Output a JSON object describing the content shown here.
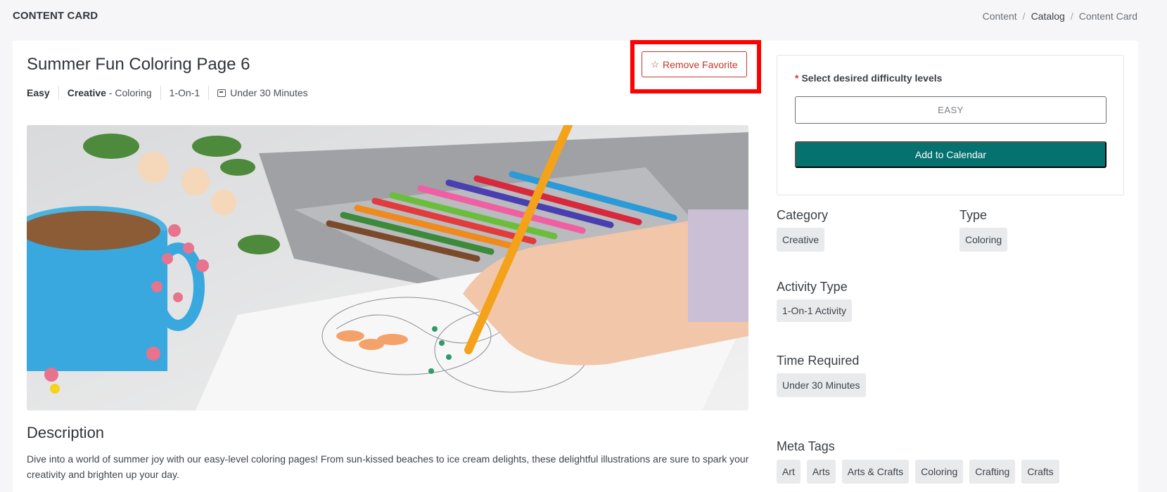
{
  "header": {
    "title": "CONTENT CARD",
    "breadcrumb": [
      "Content",
      "Catalog",
      "Content Card"
    ]
  },
  "content": {
    "title": "Summer Fun Coloring Page 6",
    "meta": {
      "difficulty": "Easy",
      "category_bold": "Creative",
      "category_rest": "- Coloring",
      "activity": "1-On-1",
      "time": "Under 30 Minutes"
    },
    "favorite_button": "Remove Favorite",
    "hero_image_alt": "Hand coloring a page with pencils",
    "description_title": "Description",
    "description_text": "Dive into a world of summer joy with our easy-level coloring pages! From sun-kissed beaches to ice cream delights, these delightful illustrations are sure to spark your creativity and brighten up your day."
  },
  "sidebar": {
    "difficulty_label": "Select desired difficulty levels",
    "required_mark": "*",
    "difficulty_value": "EASY",
    "add_button": "Add to Calendar",
    "category_label": "Category",
    "category_value": "Creative",
    "type_label": "Type",
    "type_value": "Coloring",
    "activity_type_label": "Activity Type",
    "activity_type_value": "1-On-1 Activity",
    "time_label": "Time Required",
    "time_value": "Under 30 Minutes",
    "meta_tags_label": "Meta Tags",
    "meta_tags": [
      "Art",
      "Arts",
      "Arts & Crafts",
      "Coloring",
      "Crafting",
      "Crafts"
    ]
  },
  "colors": {
    "accent": "#057270",
    "favorite": "#c0392b",
    "highlight": "#ff0000"
  },
  "icons": {
    "favorite": "star-outline-icon",
    "time": "clock-icon"
  }
}
